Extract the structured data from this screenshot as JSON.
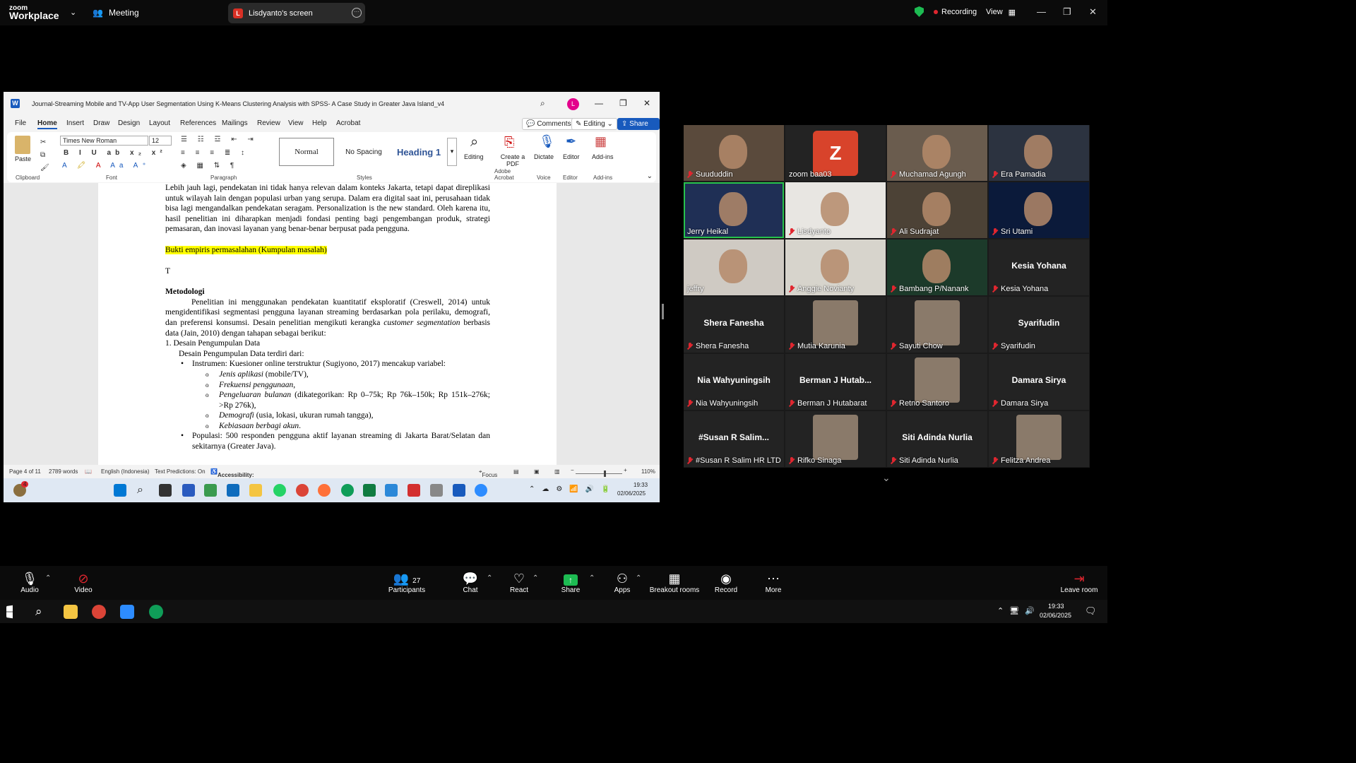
{
  "zoom": {
    "logo_line1": "zoom",
    "logo_line2": "Workplace",
    "meeting_label": "Meeting",
    "screen_share": {
      "initial": "L",
      "label": "Lisdyanto's screen"
    },
    "recording_label": "Recording",
    "view_label": "View"
  },
  "word": {
    "title": "Journal-Streaming Mobile and TV-App User Segmentation Using K-Means Clustering Analysis with SPSS- A Case Study in Greater Java Island_v4",
    "avatar_initial": "L",
    "tabs": [
      "File",
      "Home",
      "Insert",
      "Draw",
      "Design",
      "Layout",
      "References",
      "Mailings",
      "Review",
      "View",
      "Help",
      "Acrobat"
    ],
    "active_tab": "Home",
    "comments_label": "Comments",
    "editing_label": "Editing",
    "share_label": "Share",
    "ribbon": {
      "paste_label": "Paste",
      "clipboard_label": "Clipboard",
      "font_name": "Times New Roman",
      "font_size": "12",
      "font_label": "Font",
      "paragraph_label": "Paragraph",
      "styles": [
        "Normal",
        "No Spacing",
        "Heading 1"
      ],
      "styles_label": "Styles",
      "editing_label": "Editing",
      "create_pdf_label": "Create a PDF",
      "adobe_label": "Adobe Acrobat",
      "dictate_label": "Dictate",
      "voice_label": "Voice",
      "editor_label": "Editor",
      "editor_group_label": "Editor",
      "addins_label": "Add-ins",
      "addins_group_label": "Add-ins"
    },
    "doc": {
      "para1": "Lebih jauh lagi, pendekatan ini tidak hanya relevan dalam konteks Jakarta, tetapi dapat direplikasi untuk wilayah lain dengan populasi urban yang serupa. Dalam era digital saat ini, perusahaan tidak bisa lagi mengandalkan pendekatan seragam. Personalization is the new standard. Oleh karena itu, hasil penelitian ini diharapkan menjadi fondasi penting bagi pengembangan produk, strategi pemasaran, dan inovasi layanan yang benar-benar berpusat pada pengguna.",
      "highlight": "Bukti empiris permasalahan (Kumpulan masalah)",
      "t_line": "T",
      "heading": "Metodologi",
      "para2_a": "Penelitian ini menggunakan pendekatan kuantitatif eksploratif (Creswell, 2014) untuk mengidentifikasi segmentasi pengguna layanan streaming berdasarkan pola perilaku, demografi, dan preferensi konsumsi. Desain penelitian mengikuti kerangka ",
      "para2_italic": "customer segmentation",
      "para2_b": " berbasis data (Jain, 2010) dengan tahapan sebagai berikut:",
      "item1": "1. Desain Pengumpulan Data",
      "item1_sub": "Desain Pengumpulan Data terdiri dari:",
      "bullet1": "Instrumen: Kuesioner online terstruktur (Sugiyono, 2017) mencakup variabel:",
      "sub_items": [
        {
          "italic": "Jenis aplikasi",
          "rest": " (mobile/TV),"
        },
        {
          "italic": "Frekuensi penggunaan",
          "rest": ","
        },
        {
          "italic": "Pengeluaran bulanan",
          "rest": " (dikategorikan: Rp 0–75k; Rp 76k–150k; Rp 151k–276k; >Rp 276k),"
        },
        {
          "italic": "Demografi",
          "rest": " (usia, lokasi, ukuran rumah tangga),"
        },
        {
          "italic": "Kebiasaan berbagi akun",
          "rest": "."
        }
      ],
      "bullet2": "Populasi: 500 responden pengguna aktif layanan streaming di Jakarta Barat/Selatan dan sekitarnya (Greater Java)."
    },
    "status": {
      "page": "Page 4 of 11",
      "words": "2789 words",
      "language": "English (Indonesia)",
      "predictions": "Text Predictions: On",
      "accessibility": "Accessibility: Investigate",
      "focus": "Focus",
      "zoom": "110%"
    },
    "inner_taskbar": {
      "time": "19:33",
      "date": "02/06/2025",
      "badge": "4"
    }
  },
  "gallery": [
    {
      "name": "Suududdin",
      "type": "video",
      "muted": true
    },
    {
      "name": "zoom baa03",
      "type": "avatar",
      "initial": "Z",
      "muted": false
    },
    {
      "name": "Muchamad Agungh",
      "type": "video",
      "muted": true
    },
    {
      "name": "Era Pamadia",
      "type": "video",
      "muted": true
    },
    {
      "name": "Jerry Heikal",
      "type": "video",
      "muted": false,
      "active": true
    },
    {
      "name": "Lisdyanto",
      "type": "video",
      "muted": true
    },
    {
      "name": "Ali Sudrajat",
      "type": "video",
      "muted": true
    },
    {
      "name": "Sri Utami",
      "type": "video",
      "muted": true
    },
    {
      "name": "jeffry",
      "type": "video",
      "muted": false
    },
    {
      "name": "Anggie Novianty",
      "type": "video",
      "muted": true
    },
    {
      "name": "Bambang P/Nanank",
      "type": "video",
      "muted": true
    },
    {
      "name": "Kesia Yohana",
      "type": "text",
      "big": "Kesia Yohana",
      "muted": true
    },
    {
      "name": "Shera Fanesha",
      "type": "text",
      "big": "Shera Fanesha",
      "muted": true
    },
    {
      "name": "Mutia Karunia",
      "type": "photo",
      "muted": true
    },
    {
      "name": "Sayuti Chow",
      "type": "photo",
      "muted": true
    },
    {
      "name": "Syarifudin",
      "type": "text",
      "big": "Syarifudin",
      "muted": true
    },
    {
      "name": "Nia Wahyuningsih",
      "type": "text",
      "big": "Nia Wahyuningsih",
      "muted": true
    },
    {
      "name": "Berman J Hutabarat",
      "type": "text",
      "big": "Berman J Hutab...",
      "muted": true
    },
    {
      "name": "Retno Santoro",
      "type": "photo",
      "muted": true
    },
    {
      "name": "Damara Sirya",
      "type": "text",
      "big": "Damara Sirya",
      "muted": true
    },
    {
      "name": "#Susan R Salim HR LTD",
      "type": "text",
      "big": "#Susan R Salim...",
      "muted": true
    },
    {
      "name": "Rifko Sinaga",
      "type": "photo",
      "muted": true
    },
    {
      "name": "Siti Adinda Nurlia",
      "type": "text",
      "big": "Siti Adinda Nurlia",
      "muted": true
    },
    {
      "name": "Felitza Andrea",
      "type": "photo",
      "muted": true
    }
  ],
  "controls": {
    "audio": "Audio",
    "video": "Video",
    "participants": "Participants",
    "participants_count": "27",
    "chat": "Chat",
    "react": "React",
    "share": "Share",
    "apps": "Apps",
    "breakout": "Breakout rooms",
    "record": "Record",
    "more": "More",
    "leave": "Leave room"
  },
  "windows_taskbar": {
    "time": "19:33",
    "date": "02/06/2025"
  }
}
